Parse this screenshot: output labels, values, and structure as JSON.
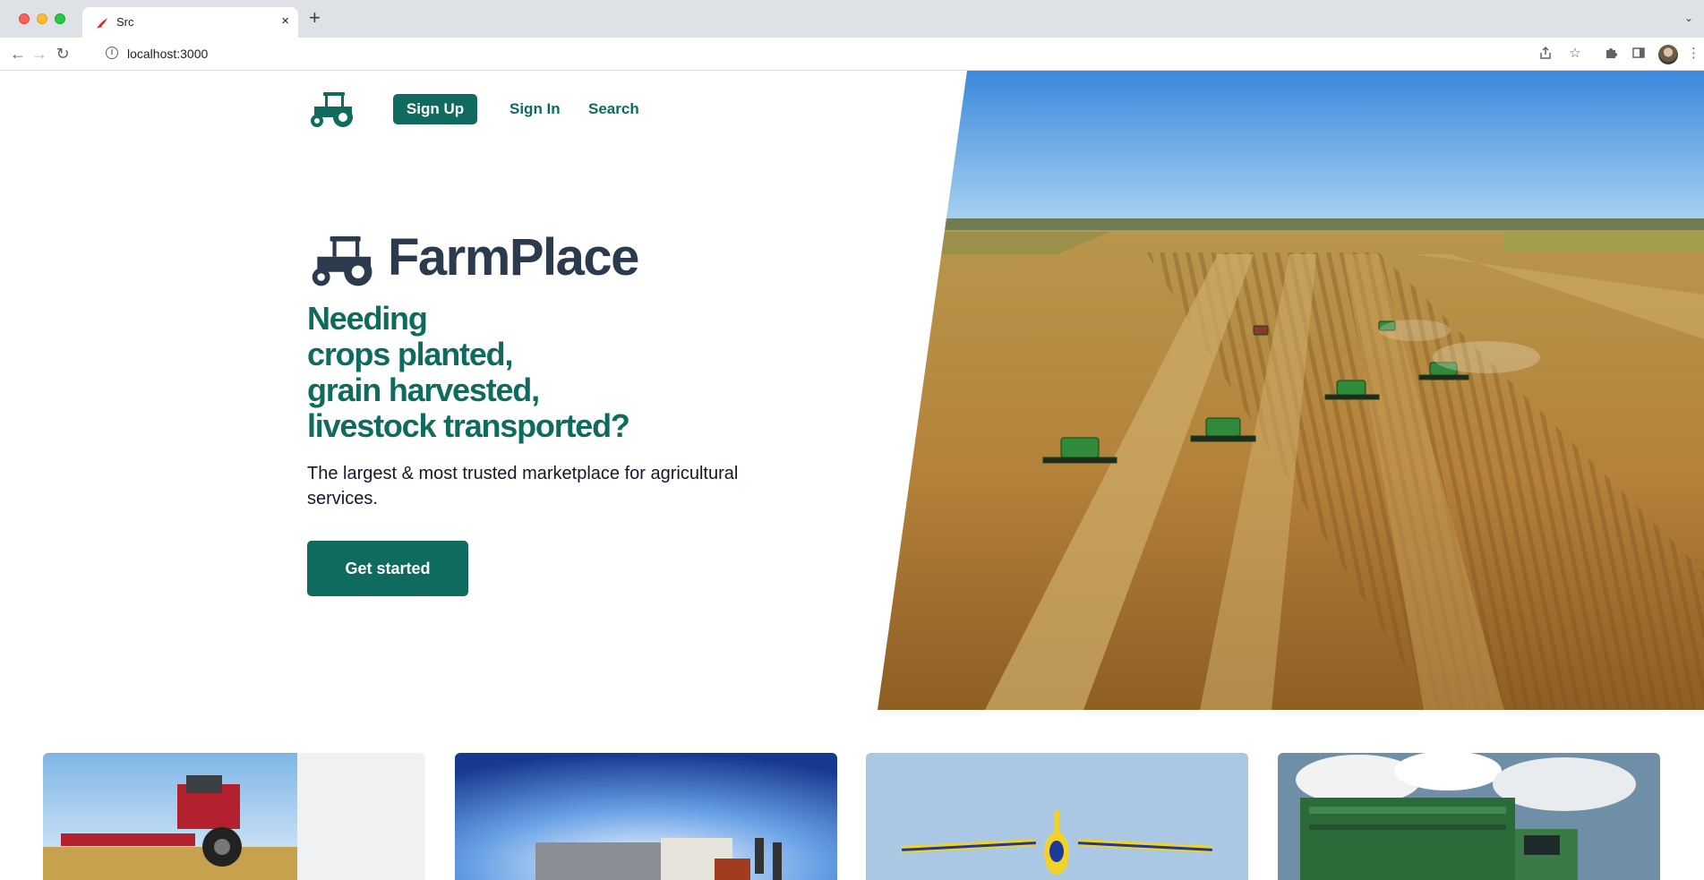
{
  "browser": {
    "tab_title": "Src",
    "url": "localhost:3000",
    "new_tab_label": "+",
    "close_label": "×"
  },
  "nav": {
    "sign_up": "Sign Up",
    "sign_in": "Sign In",
    "search": "Search"
  },
  "hero": {
    "brand_name": "FarmPlace",
    "headline": [
      "Needing",
      "crops planted,",
      "grain harvested,",
      "livestock transported?"
    ],
    "subtext": "The largest & most trusted marketplace for agricultural services.",
    "cta": "Get started",
    "image": "aerial-harvest-field-photo"
  },
  "cards": [
    {
      "image": "red-combine-harvester-photo"
    },
    {
      "image": "livestock-truck-photo"
    },
    {
      "image": "crop-duster-plane-photo"
    },
    {
      "image": "green-cotton-picker-photo"
    }
  ],
  "colors": {
    "brand_green": "#0f6b5e",
    "brand_navy": "#2c3a4e",
    "text": "#111827"
  }
}
